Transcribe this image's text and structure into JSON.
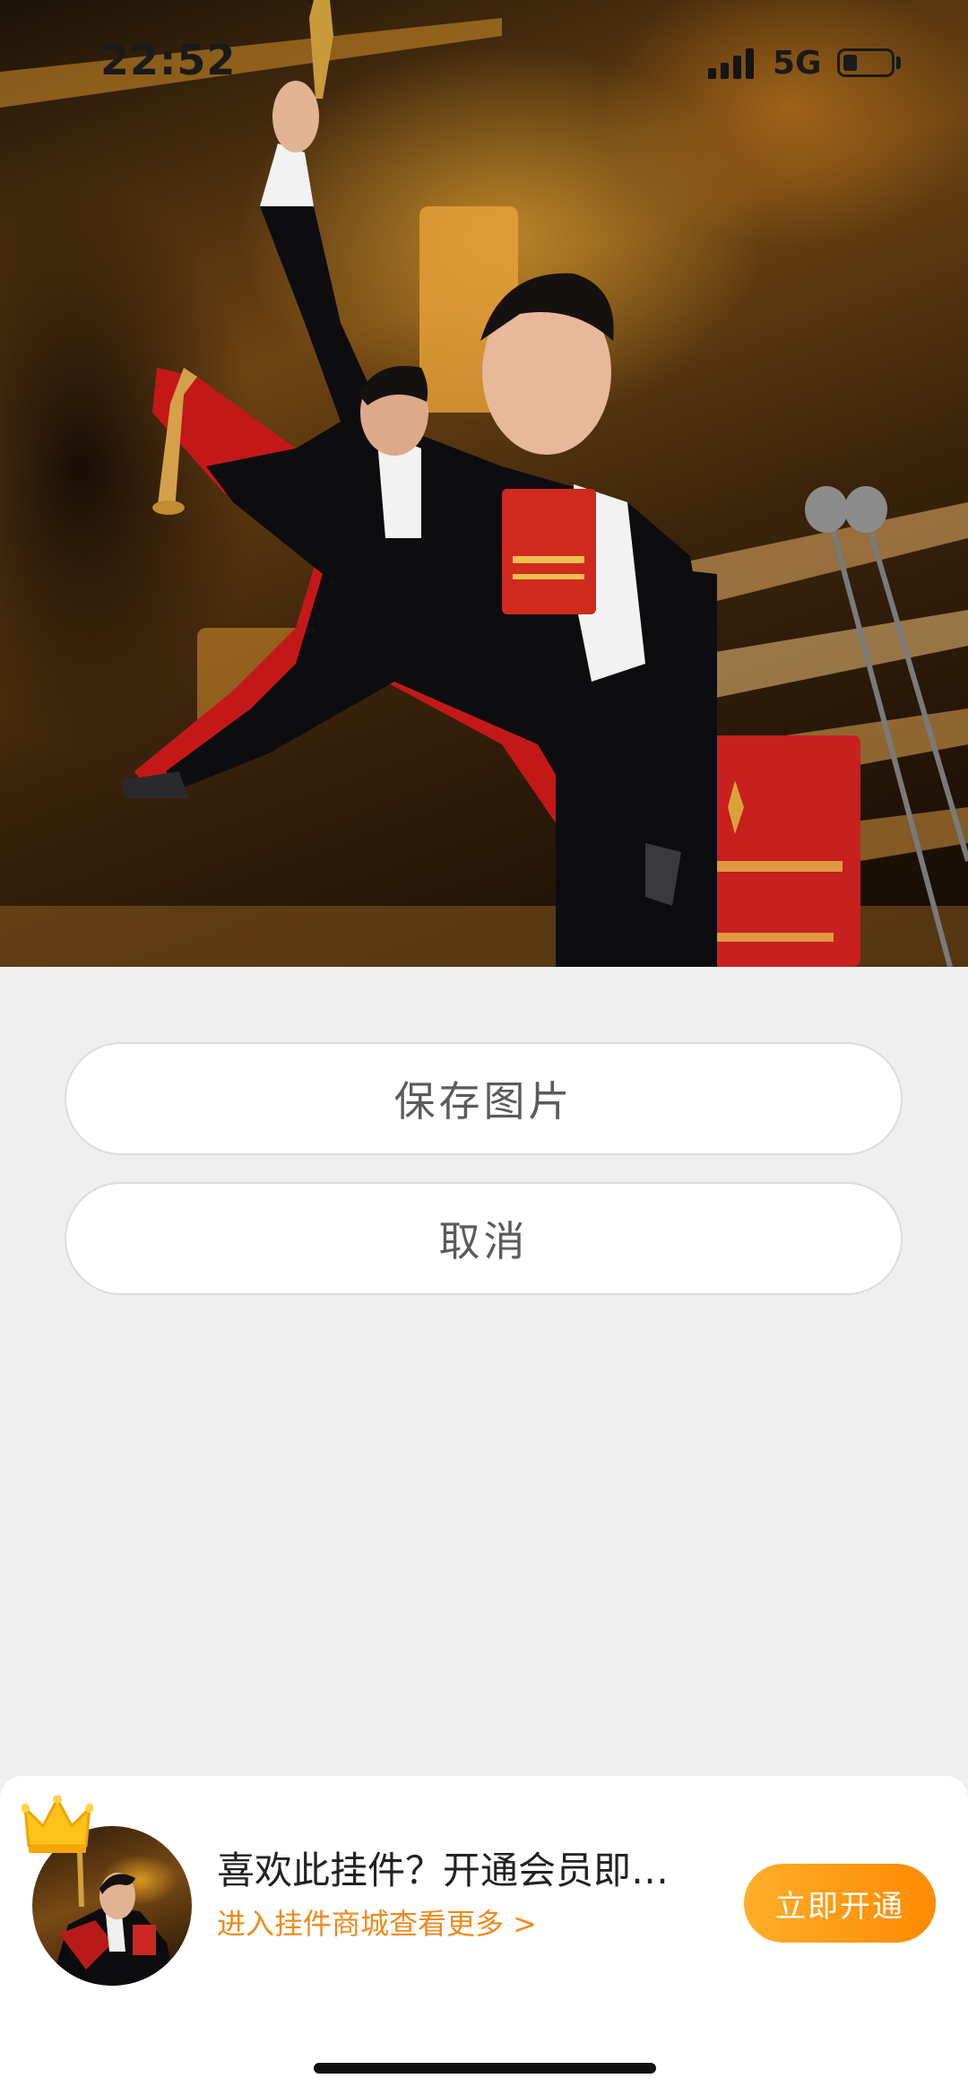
{
  "status_bar": {
    "time": "22:52",
    "network": "5G",
    "battery_level": 0.3
  },
  "image_preview": {
    "scene": "awards-ceremony-photo"
  },
  "actions": {
    "save_label": "保存图片",
    "cancel_label": "取消"
  },
  "promo": {
    "title": "喜欢此挂件？开通会员即…",
    "link": "进入挂件商城查看更多 >",
    "cta_label": "立即开通",
    "accent_color": "#ff9a14"
  },
  "colors": {
    "background": "#efefef",
    "button_text": "#5b5b5b",
    "link": "#f08a1c"
  }
}
